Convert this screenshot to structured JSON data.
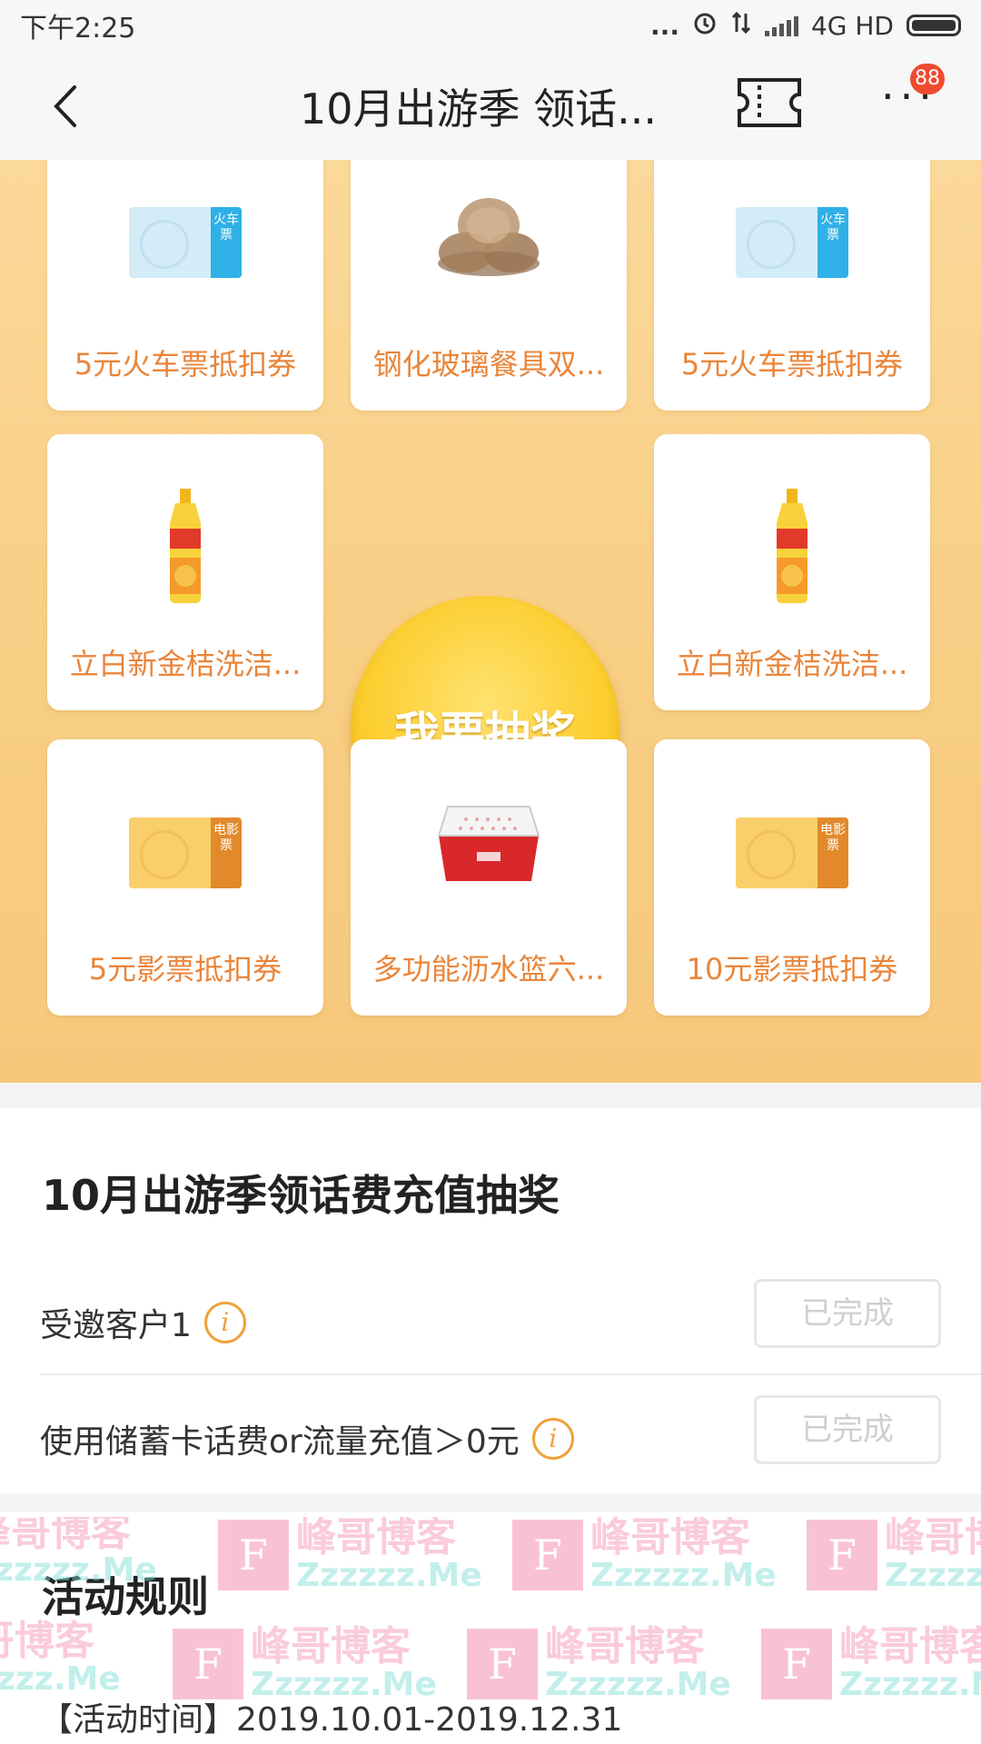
{
  "status_bar": {
    "time": "下午2:25",
    "dots": "...",
    "network": "4G HD"
  },
  "nav": {
    "title": "10月出游季 领话...",
    "more": "···",
    "badge_count": "88"
  },
  "prizes": {
    "top_left": {
      "label": "5元火车票抵扣券",
      "tag": "火车票"
    },
    "top_middle": {
      "label": "钢化玻璃餐具双..."
    },
    "top_right": {
      "label": "5元火车票抵扣券",
      "tag": "火车票"
    },
    "middle_left": {
      "label": "立白新金桔洗洁..."
    },
    "middle_right": {
      "label": "立白新金桔洗洁..."
    },
    "bottom_left": {
      "label": "5元影票抵扣券",
      "tag": "电影票"
    },
    "bottom_middle": {
      "label": "多功能沥水篮六..."
    },
    "bottom_right": {
      "label": "10元影票抵扣券",
      "tag": "电影票"
    }
  },
  "draw_button": {
    "label": "我要抽奖"
  },
  "tasks": {
    "title": "10月出游季领话费充值抽奖",
    "items": [
      {
        "text": "受邀客户1",
        "button": "已完成"
      },
      {
        "text": "使用储蓄卡话费or流量充值＞0元",
        "button": "已完成"
      }
    ]
  },
  "rules": {
    "title": "活动规则",
    "time": "【活动时间】2019.10.01-2019.12.31"
  },
  "watermark": {
    "logo_letter": "F",
    "cn_text": "峰哥博客",
    "en_text": "Zzzzzz.Me"
  },
  "colors": {
    "accent_orange": "#e9853a",
    "lottery_bg": "#f8cf86",
    "draw_button": "#fbcc2b",
    "badge_red": "#f04a2f",
    "train_ticket_blue": "#2fb0e6",
    "movie_ticket_orange": "#e28a2b"
  }
}
